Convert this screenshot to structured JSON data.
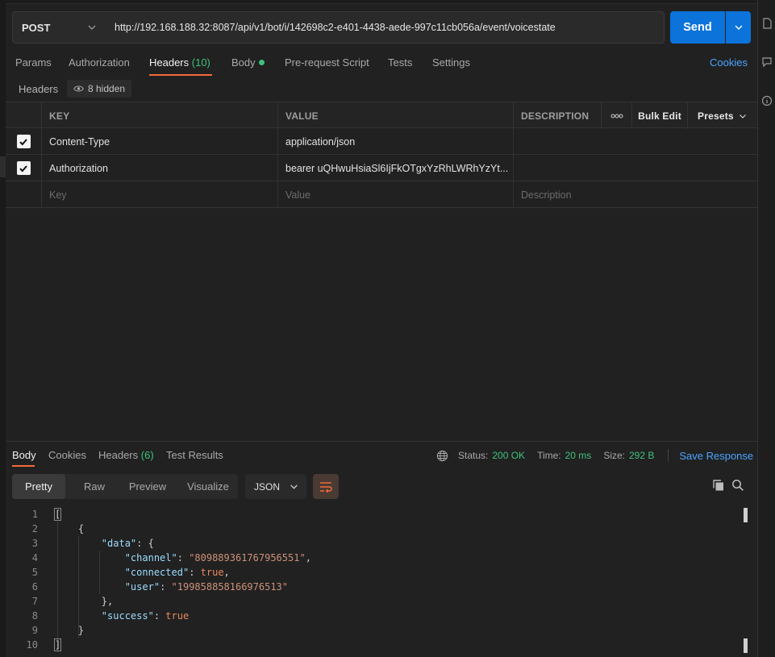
{
  "request": {
    "method": "POST",
    "url": "http://192.168.188.32:8087/api/v1/bot/i/142698c2-e401-4438-aede-997c11cb056a/event/voicestate",
    "send_label": "Send"
  },
  "tabs": {
    "params": "Params",
    "authorization": "Authorization",
    "headers": "Headers",
    "headers_count": "(10)",
    "body": "Body",
    "prerequest": "Pre-request Script",
    "tests": "Tests",
    "settings": "Settings",
    "cookies": "Cookies"
  },
  "headers_section": {
    "label": "Headers",
    "hidden": "8 hidden",
    "columns": {
      "key": "KEY",
      "value": "VALUE",
      "description": "DESCRIPTION",
      "bulk_edit": "Bulk Edit",
      "presets": "Presets"
    },
    "rows": [
      {
        "key": "Content-Type",
        "value": "application/json",
        "checked": true
      },
      {
        "key": "Authorization",
        "value": "bearer uQHwuHsiaSl6IjFkOTgxYzRhLWRhYzYt...",
        "checked": true
      }
    ],
    "placeholder": {
      "key": "Key",
      "value": "Value",
      "description": "Description"
    }
  },
  "response": {
    "tabs": {
      "body": "Body",
      "cookies": "Cookies",
      "headers": "Headers",
      "headers_count": "(6)",
      "test_results": "Test Results"
    },
    "status_label": "Status:",
    "status_value": "200 OK",
    "time_label": "Time:",
    "time_value": "20 ms",
    "size_label": "Size:",
    "size_value": "292 B",
    "save_response": "Save Response",
    "views": {
      "pretty": "Pretty",
      "raw": "Raw",
      "preview": "Preview",
      "visualize": "Visualize"
    },
    "format": "JSON",
    "code": {
      "lines": [
        "1",
        "2",
        "3",
        "4",
        "5",
        "6",
        "7",
        "8",
        "9",
        "10"
      ],
      "channel_key": "\"channel\"",
      "channel_val": "\"809889361767956551\"",
      "connected_key": "\"connected\"",
      "connected_val": "true",
      "user_key": "\"user\"",
      "user_val": "\"199858858166976513\"",
      "data_key": "\"data\"",
      "success_key": "\"success\"",
      "success_val": "true"
    }
  }
}
